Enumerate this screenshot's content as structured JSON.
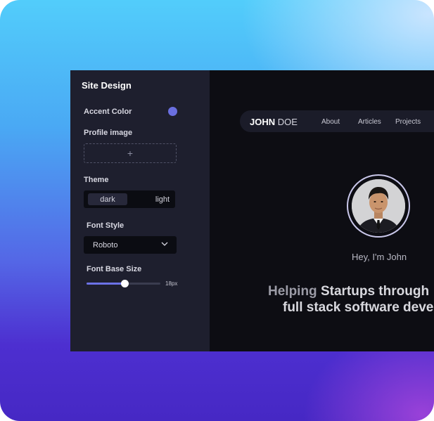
{
  "panel": {
    "title": "Site Design",
    "accent_color_label": "Accent Color",
    "accent_color": "#6a6fe0",
    "profile_image_label": "Profile image",
    "upload_glyph": "+",
    "theme_label": "Theme",
    "theme_options": [
      "dark",
      "light"
    ],
    "theme_selected": "dark",
    "font_style_label": "Font Style",
    "font_style_value": "Roboto",
    "font_base_size_label": "Font Base Size",
    "font_base_size_value": "18px",
    "font_base_size_fraction": 0.51
  },
  "preview": {
    "brand_first": "JOHN",
    "brand_last": "DOE",
    "nav": [
      "About",
      "Articles",
      "Projects"
    ],
    "greeting": "Hey, I'm John",
    "hero_line1_dim": "Helping ",
    "hero_line1_bold": "Startups through",
    "hero_line2": "full stack software deve"
  },
  "icons": {
    "upload": "plus-icon",
    "select": "chevron-down-icon"
  }
}
